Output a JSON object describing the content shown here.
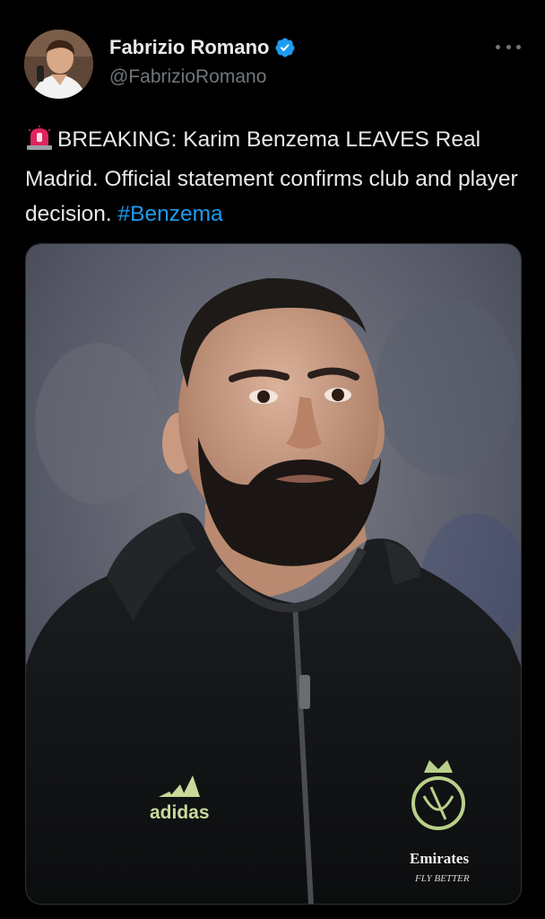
{
  "author": {
    "display_name": "Fabrizio Romano",
    "handle": "@FabrizioRomano",
    "verified": true,
    "avatar_icon": "profile-photo"
  },
  "tweet": {
    "emoji": "police-siren-emoji",
    "text": "BREAKING: Karim Benzema LEAVES Real Madrid. Official statement confirms club and player decision.",
    "hashtag": "#Benzema"
  },
  "media": {
    "kind": "photo",
    "subject": "player-portrait",
    "jacket_logo_text": "adidas",
    "sponsor_line1": "Emirates",
    "sponsor_line2": "FLY BETTER"
  },
  "colors": {
    "background": "#000000",
    "text": "#e7e9ea",
    "muted": "#71767b",
    "link": "#1d9bf0",
    "verified": "#1d9bf0"
  }
}
